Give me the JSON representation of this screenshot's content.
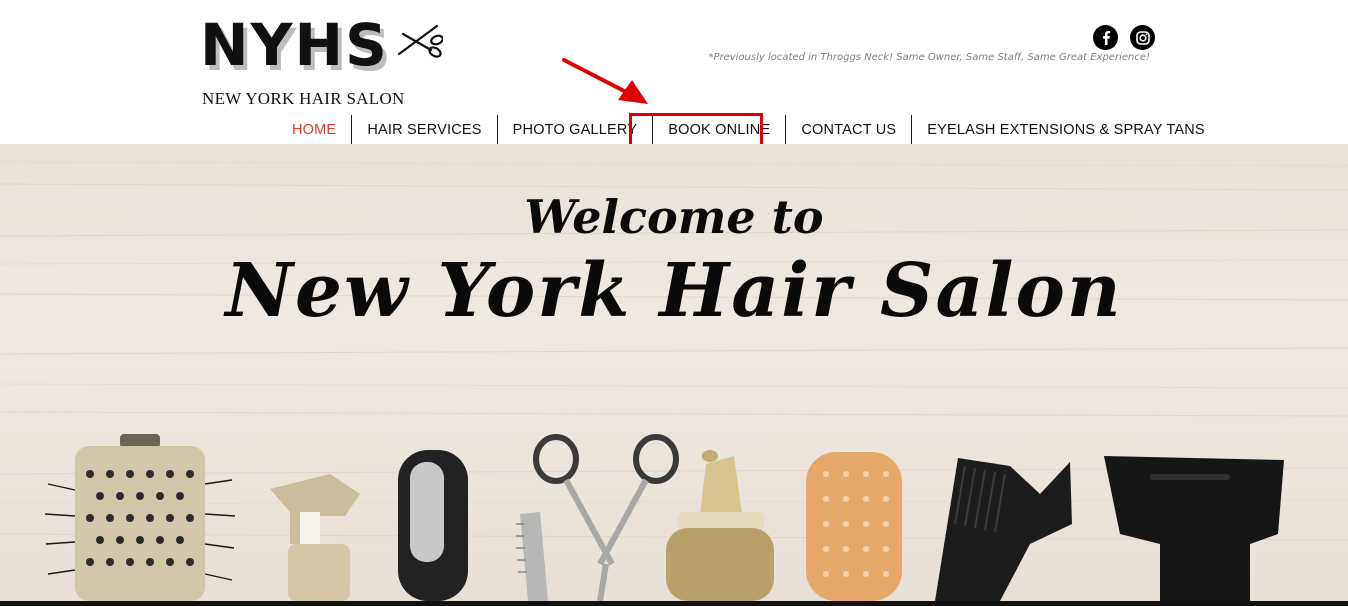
{
  "brand": {
    "logo_text": "NYHS",
    "subtitle": "NEW YORK HAIR SALON"
  },
  "header": {
    "tagline": "*Previously located in Throggs Neck! Same Owner, Same Staff, Same Great Experience!",
    "social": [
      {
        "icon": "facebook-icon"
      },
      {
        "icon": "instagram-icon"
      }
    ]
  },
  "nav": {
    "items": [
      {
        "label": "HOME",
        "active": true
      },
      {
        "label": "HAIR SERVICES",
        "active": false
      },
      {
        "label": "PHOTO GALLERY",
        "active": false
      },
      {
        "label": "BOOK ONLINE",
        "active": false,
        "highlighted": true
      },
      {
        "label": "CONTACT US",
        "active": false
      },
      {
        "label": "EYELASH EXTENSIONS & SPRAY TANS",
        "active": false
      }
    ]
  },
  "hero": {
    "welcome": "Welcome to",
    "title": "New York Hair Salon"
  },
  "colors": {
    "active_nav": "#d93b2b",
    "annotation_red": "#e00000",
    "text": "#111111"
  }
}
